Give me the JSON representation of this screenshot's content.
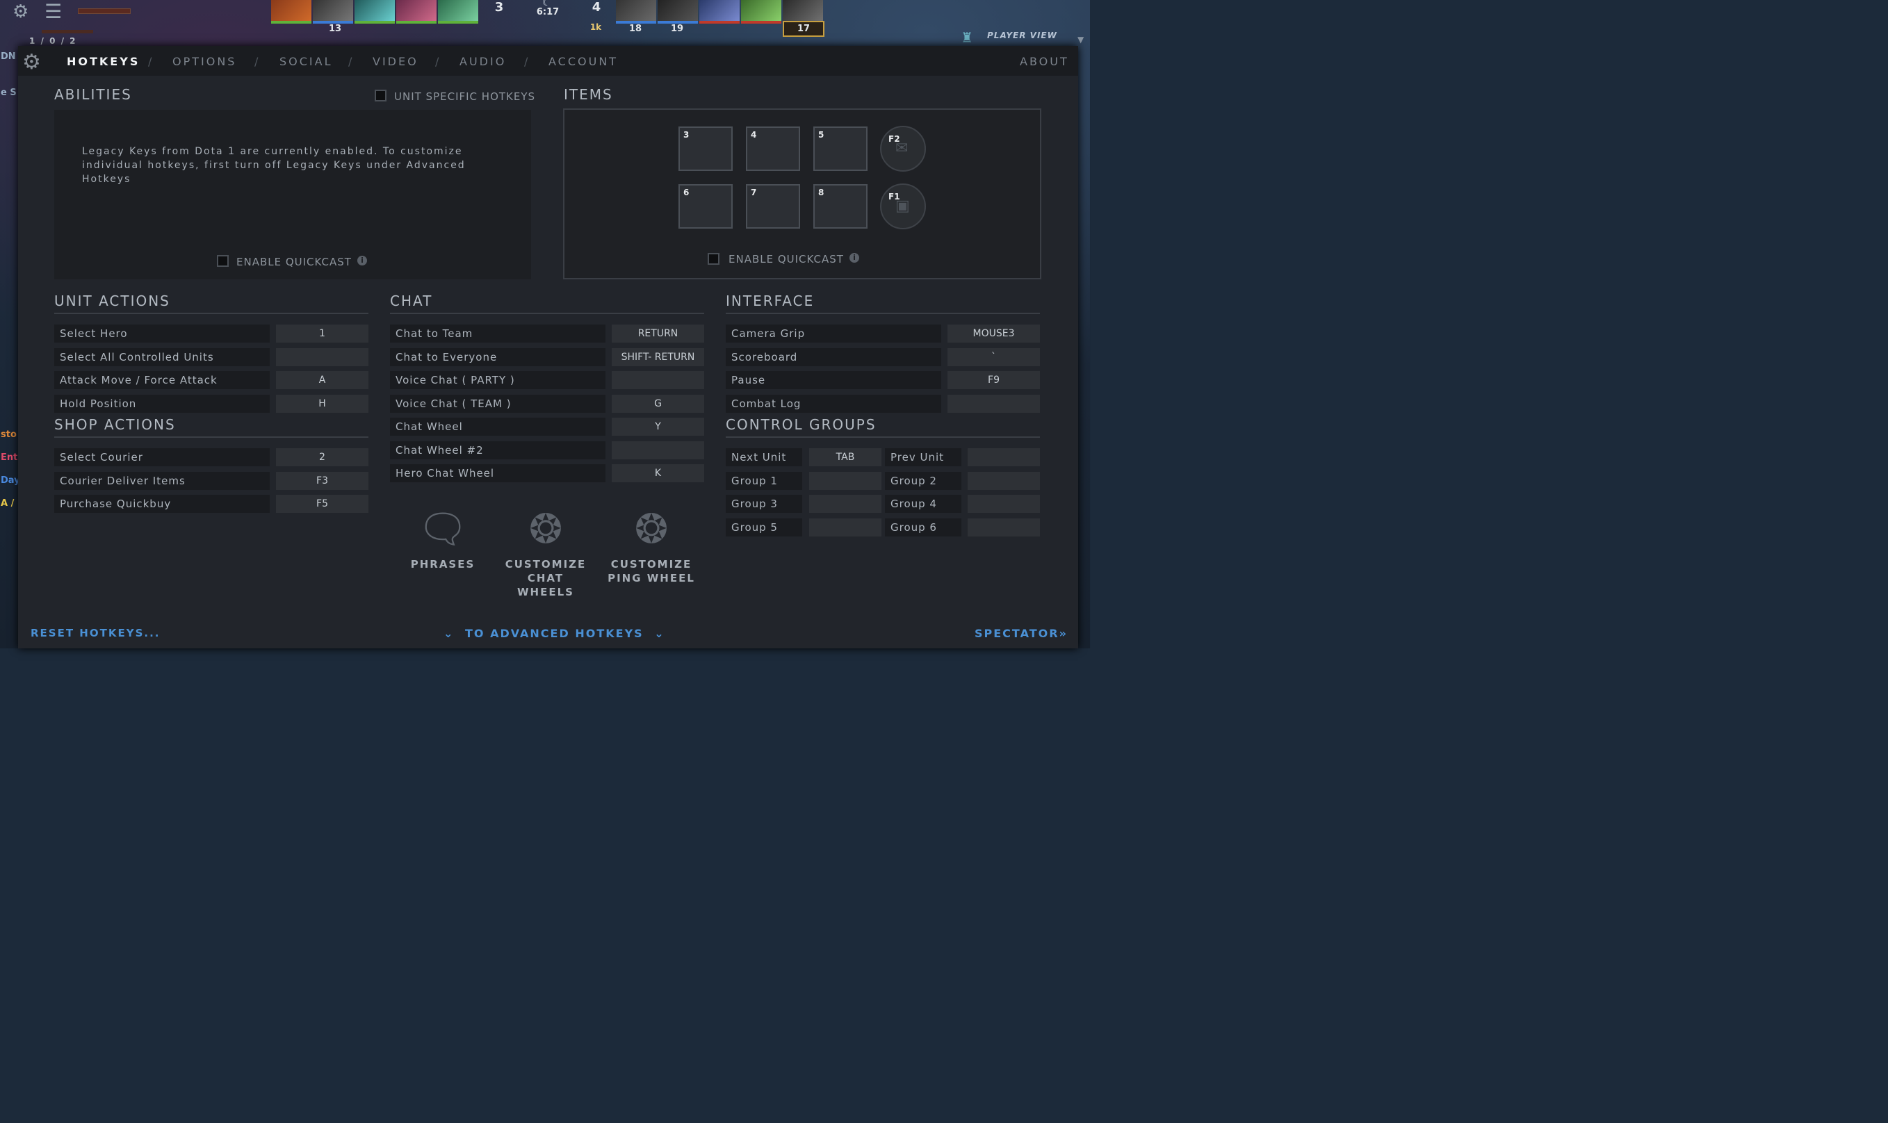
{
  "hud": {
    "kda": "1 / 0 / 2",
    "score_radiant": "3",
    "score_dire": "4",
    "clock": "6:17",
    "gold_lead": "1k",
    "portrait_numbers": {
      "radiant_player": "13",
      "dire_a": "18",
      "dire_b": "19",
      "dire_selected": "17"
    },
    "player_view": "PLAYER VIEW",
    "left_strip": [
      "DN",
      "e S",
      "sto",
      "Ent",
      "Day",
      "A /"
    ]
  },
  "nav": {
    "tabs": [
      "HOTKEYS",
      "OPTIONS",
      "SOCIAL",
      "VIDEO",
      "AUDIO",
      "ACCOUNT"
    ],
    "separator": "/",
    "about": "ABOUT"
  },
  "abilities": {
    "title": "ABILITIES",
    "unit_specific_label": "UNIT SPECIFIC HOTKEYS",
    "legacy_message": "Legacy Keys from Dota 1 are currently enabled. To customize individual hotkeys, first turn off Legacy Keys under Advanced Hotkeys",
    "quickcast_label": "ENABLE QUICKCAST"
  },
  "items": {
    "title": "ITEMS",
    "slots": [
      "3",
      "4",
      "5",
      "6",
      "7",
      "8"
    ],
    "neutral_slots": [
      "F2",
      "F1"
    ],
    "quickcast_label": "ENABLE QUICKCAST"
  },
  "unit_actions": {
    "title": "UNIT ACTIONS",
    "rows": [
      {
        "label": "Select Hero",
        "key": "1"
      },
      {
        "label": "Select All Controlled Units",
        "key": ""
      },
      {
        "label": "Attack Move / Force Attack",
        "key": "A"
      },
      {
        "label": "Hold Position",
        "key": "H"
      }
    ]
  },
  "shop_actions": {
    "title": "SHOP ACTIONS",
    "rows": [
      {
        "label": "Select Courier",
        "key": "2"
      },
      {
        "label": "Courier Deliver Items",
        "key": "F3"
      },
      {
        "label": "Purchase Quickbuy",
        "key": "F5"
      }
    ]
  },
  "chat": {
    "title": "CHAT",
    "rows": [
      {
        "label": "Chat to Team",
        "key": "RETURN"
      },
      {
        "label": "Chat to Everyone",
        "key": "SHIFT- RETURN"
      },
      {
        "label": "Voice Chat ( PARTY )",
        "key": ""
      },
      {
        "label": "Voice Chat ( TEAM )",
        "key": "G"
      },
      {
        "label": "Chat Wheel",
        "key": "Y"
      },
      {
        "label": "Chat Wheel #2",
        "key": ""
      },
      {
        "label": "Hero Chat Wheel",
        "key": "K"
      }
    ],
    "buttons": [
      {
        "label": "PHRASES",
        "icon": "phrases-icon"
      },
      {
        "label": "CUSTOMIZE CHAT WHEELS",
        "icon": "chat-wheel-icon"
      },
      {
        "label": "CUSTOMIZE PING WHEEL",
        "icon": "ping-wheel-icon"
      }
    ]
  },
  "interface": {
    "title": "INTERFACE",
    "rows": [
      {
        "label": "Camera Grip",
        "key": "MOUSE3"
      },
      {
        "label": "Scoreboard",
        "key": "`"
      },
      {
        "label": "Pause",
        "key": "F9"
      },
      {
        "label": "Combat Log",
        "key": ""
      }
    ]
  },
  "control_groups": {
    "title": "CONTROL GROUPS",
    "rows": [
      {
        "label": "Next Unit",
        "key": "TAB",
        "label2": "Prev Unit",
        "key2": ""
      },
      {
        "label": "Group 1",
        "key": "",
        "label2": "Group 2",
        "key2": ""
      },
      {
        "label": "Group 3",
        "key": "",
        "label2": "Group 4",
        "key2": ""
      },
      {
        "label": "Group 5",
        "key": "",
        "label2": "Group 6",
        "key2": ""
      }
    ]
  },
  "footer": {
    "reset": "RESET HOTKEYS...",
    "advanced": "TO ADVANCED HOTKEYS",
    "spectator": "SPECTATOR"
  },
  "colors": {
    "accent": "#4a90d4",
    "panel": "#22252b",
    "key_bg": "#2e3136",
    "label_bg": "#1a1c20"
  }
}
